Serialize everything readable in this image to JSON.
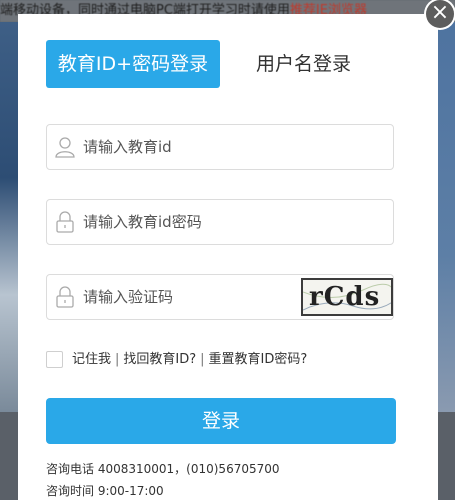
{
  "background": {
    "top_text": "端移动设备，同时通过电脑PC端打开学习时请使用",
    "top_text_tail": "推荐IE浏览器"
  },
  "close_icon": "×",
  "tabs": {
    "active": "教育ID+密码登录",
    "inactive": "用户名登录"
  },
  "fields": {
    "user_placeholder": "请输入教育id",
    "password_placeholder": "请输入教育id密码",
    "code_placeholder": "请输入验证码",
    "captcha_text": "rCds"
  },
  "remember": {
    "remember_label": "记住我",
    "find_id": "找回教育ID?",
    "reset_password": "重置教育ID密码?"
  },
  "login_label": "登录",
  "contact": {
    "phone": "咨询电话 4008310001，(010)56705700",
    "hours": "咨询时间 9:00-17:00"
  },
  "colors": {
    "accent": "#2aa8e8",
    "overlay": "#5a6068"
  }
}
